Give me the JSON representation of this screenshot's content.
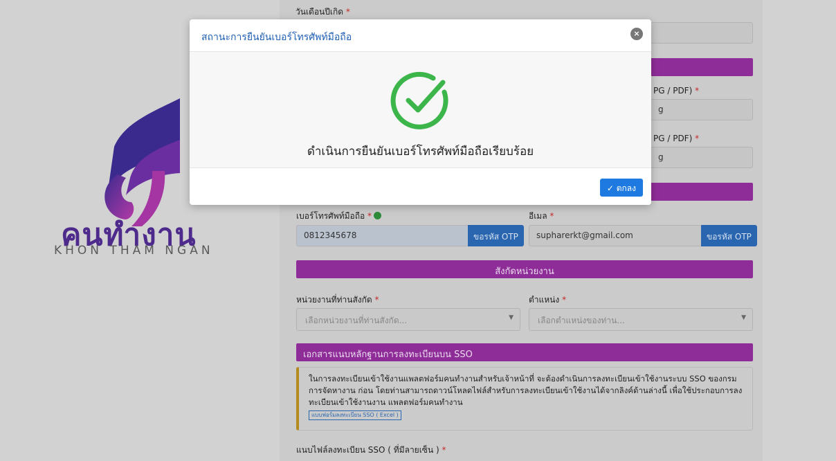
{
  "brand": {
    "word": "คนทำงาน",
    "sub": "KHON THAM NGAN",
    "colors": {
      "dark": "#3b2a8e",
      "mid": "#7a2a9a",
      "light": "#b43aa6"
    }
  },
  "form": {
    "dob_label": "วันเดือนปีเกิด",
    "file_label_1": "PG / PDF)",
    "file_label_2": "PG / PDF)",
    "file_value_1": "g",
    "file_value_2": "g",
    "phone_label": "เบอร์โทรศัพท์มือถือ",
    "phone_value": "0812345678",
    "phone_otp": "ขอรหัส OTP",
    "email_label": "อีเมล",
    "email_value": "supharerkt@gmail.com",
    "email_otp": "ขอรหัส OTP",
    "band_org": "สังกัดหน่วยงาน",
    "org_label": "หน่วยงานที่ท่านสังกัด",
    "org_placeholder": "เลือกหน่วยงานที่ท่านสังกัด...",
    "position_label": "ตำแหน่ง",
    "position_placeholder": "เลือกตำแหน่งของท่าน...",
    "band_sso": "เอกสารแนบหลักฐานการลงทะเบียนบน SSO",
    "note_text": "ในการลงทะเบียนเข้าใช้งานแพลตฟอร์มคนทำงานสำหรับเจ้าหน้าที่ จะต้องดำเนินการลงทะเบียนเข้าใช้งานระบบ SSO ของกรมการจัดหางาน ก่อน โดยท่านสามารถดาวน์โหลดไฟล์สำหรับการลงทะเบียนเข้าใช้งานได้จากลิงค์ด้านล่างนี้ เพื่อใช้ประกอบการลงทะเบียนเข้าใช้งานงาน แพลตฟอร์มคนทำงาน",
    "note_link": "แบบฟอร์มลงทะเบียน SSO ( Excel )",
    "sso_file_label": "แนบไฟล์ลงทะเบียน SSO ( ที่มีลายเซ็น )",
    "required_mark": "*"
  },
  "modal": {
    "title": "สถานะการยืนยันเบอร์โทรศัพท์มือถือ",
    "close_glyph": "×",
    "message": "ดำเนินการยืนยันเบอร์โทรศัพท์มือถือเรียบร้อย",
    "ok_label": "ตกลง",
    "ok_glyph": "✓",
    "success_color": "#3cb54a",
    "accent": "#1e7ae0"
  }
}
